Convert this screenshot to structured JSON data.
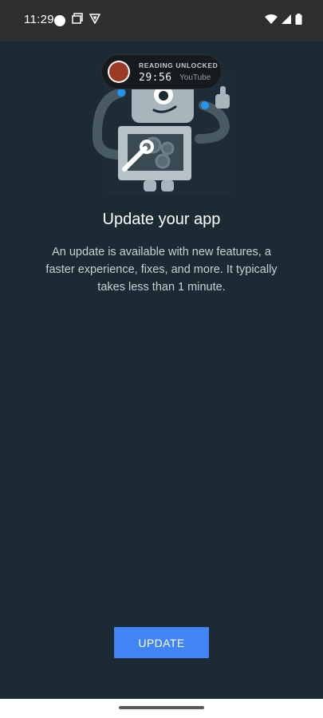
{
  "status_bar": {
    "time": "11:29",
    "left_icons": [
      "circle-notification-icon",
      "screenshot-icon",
      "vpn-shield-icon"
    ],
    "right_icons": [
      "wifi-icon",
      "cell-signal-icon",
      "battery-icon"
    ]
  },
  "recording_pill": {
    "label": "READING UNLOCKED",
    "timer": "29:56",
    "source": "YouTube",
    "record_color": "#9c3a24"
  },
  "illustration": {
    "icon": "robot-repair-illustration"
  },
  "main": {
    "title": "Update your app",
    "description": "An update is available with new features, a faster experience, fixes, and more. It typically takes less than 1 minute."
  },
  "actions": {
    "update_label": "UPDATE",
    "accent_color": "#4184f3"
  },
  "colors": {
    "background": "#1b2a33",
    "status_bar": "#2f2f31"
  }
}
